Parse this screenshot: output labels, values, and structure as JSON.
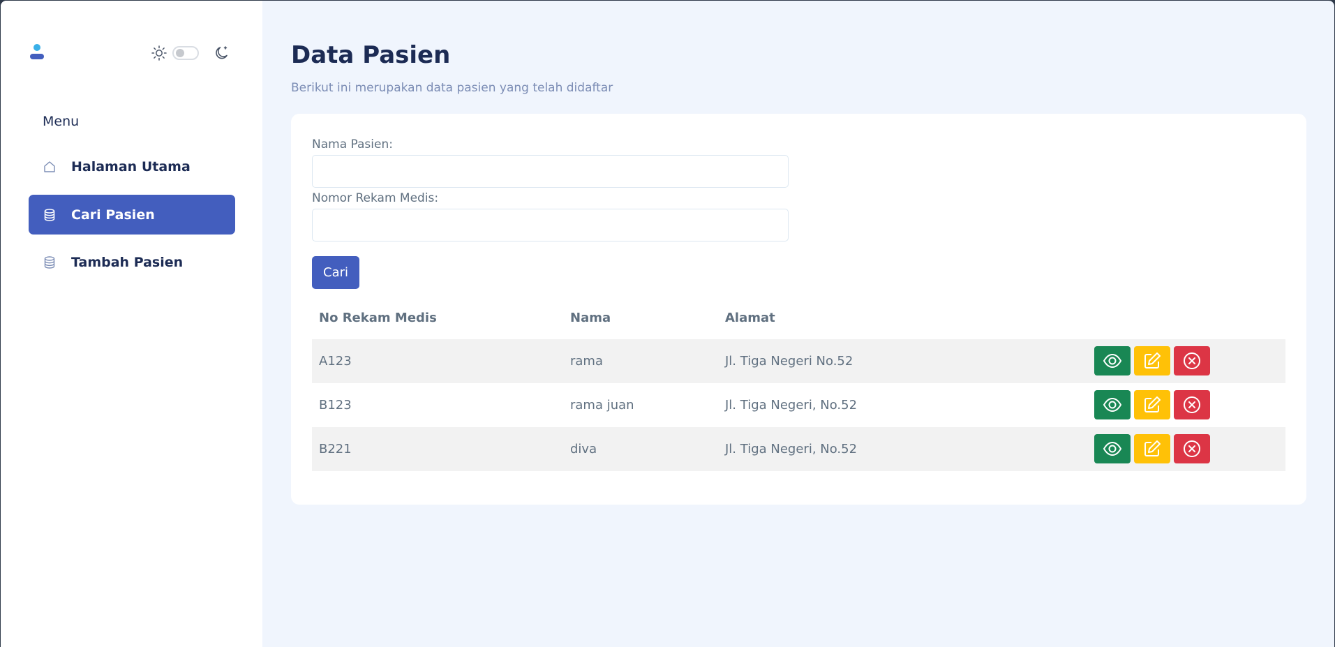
{
  "colors": {
    "primary": "#435ebe",
    "background": "#f0f5fd",
    "heading": "#1c2b54",
    "muted": "#7c8db5",
    "view": "#198754",
    "edit": "#ffc107",
    "delete": "#dc3545"
  },
  "sidebar": {
    "avatar_icon": "user-icon",
    "theme_toggle": {
      "light_icon": "sun-icon",
      "dark_icon": "moon-icon",
      "dark_mode": false
    },
    "menu_label": "Menu",
    "items": [
      {
        "label": "Halaman Utama",
        "icon": "house-icon",
        "active": false
      },
      {
        "label": "Cari Pasien",
        "icon": "database-icon",
        "active": true
      },
      {
        "label": "Tambah Pasien",
        "icon": "database-icon",
        "active": false
      }
    ]
  },
  "header": {
    "title": "Data Pasien",
    "subtitle": "Berikut ini merupakan data pasien yang telah didaftar"
  },
  "form": {
    "name_label": "Nama Pasien:",
    "name_value": "",
    "rm_label": "Nomor Rekam Medis:",
    "rm_value": "",
    "search_button": "Cari"
  },
  "table": {
    "columns": [
      "No Rekam Medis",
      "Nama",
      "Alamat"
    ],
    "rows": [
      {
        "rm": "A123",
        "nama": "rama",
        "alamat": "Jl. Tiga Negeri No.52"
      },
      {
        "rm": "B123",
        "nama": "rama juan",
        "alamat": "Jl. Tiga Negeri, No.52"
      },
      {
        "rm": "B221",
        "nama": "diva",
        "alamat": "Jl. Tiga Negeri, No.52"
      }
    ],
    "action_icons": [
      "eye-icon",
      "pencil-square-icon",
      "x-circle-icon"
    ]
  }
}
